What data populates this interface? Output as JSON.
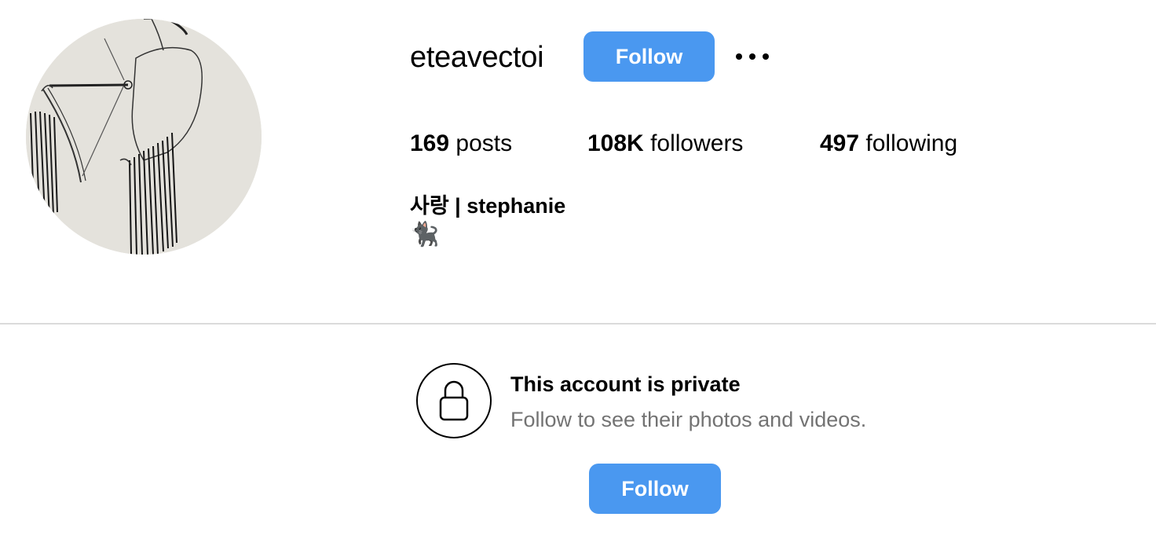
{
  "profile": {
    "username": "eteavectoi",
    "follow_label": "Follow",
    "more_label": "•••",
    "stats": {
      "posts_count": "169",
      "posts_label": "posts",
      "followers_count": "108K",
      "followers_label": "followers",
      "following_count": "497",
      "following_label": "following"
    },
    "full_name": "사랑 | stephanie",
    "bio": "🐈‍⬛"
  },
  "private_notice": {
    "icon": "lock-icon",
    "title": "This account is private",
    "subtitle": "Follow to see their photos and videos.",
    "follow_label": "Follow"
  },
  "colors": {
    "accent": "#4A98F0",
    "secondary_text": "#737373",
    "divider": "#DBDBDB"
  }
}
